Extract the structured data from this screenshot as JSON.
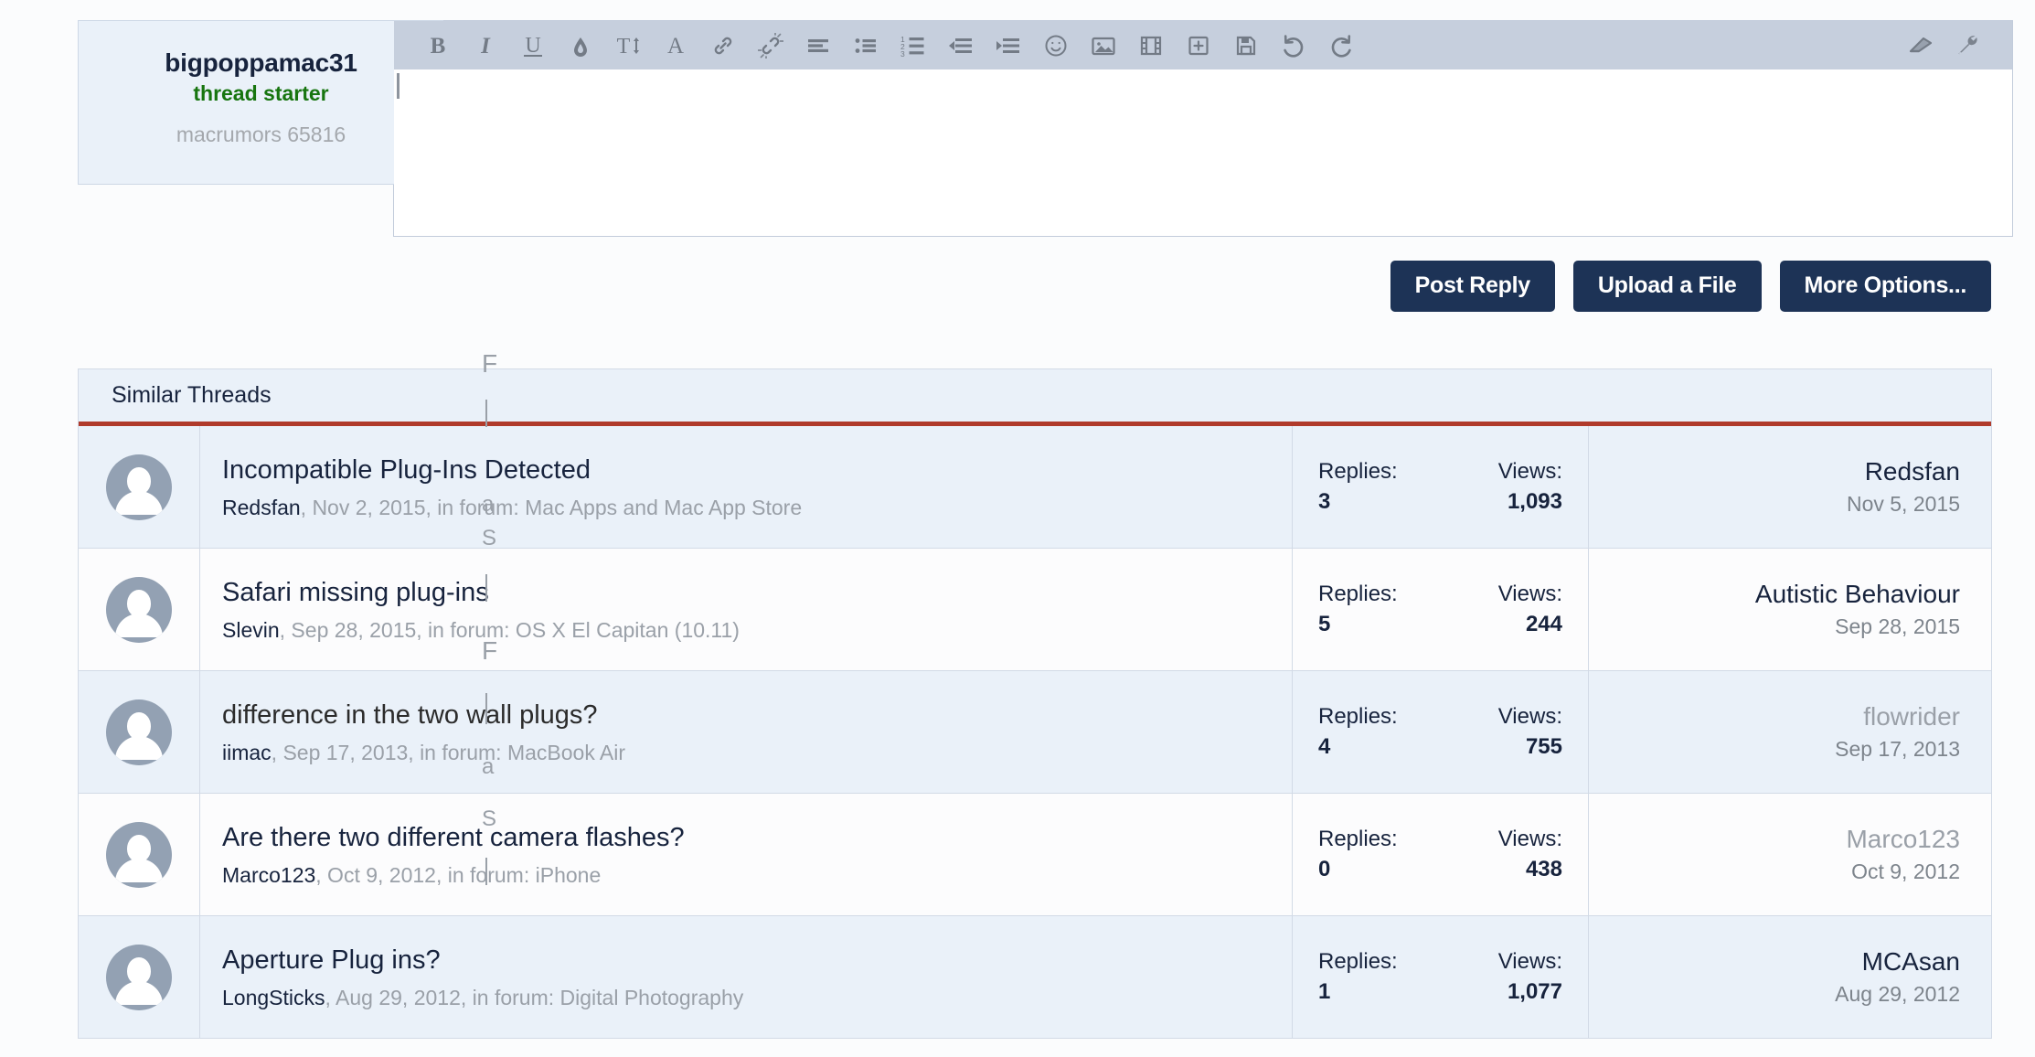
{
  "author": {
    "name": "bigpoppamac31",
    "role": "thread starter",
    "rank": "macrumors 65816"
  },
  "editor": {
    "toolbar_left": [
      {
        "name": "bold-icon",
        "label": "B"
      },
      {
        "name": "italic-icon",
        "label": "I"
      },
      {
        "name": "underline-icon",
        "label": "U"
      },
      {
        "name": "text-color-icon",
        "label": "Text Color"
      },
      {
        "name": "font-size-icon",
        "label": "Font Size"
      },
      {
        "name": "font-family-icon",
        "label": "Font"
      },
      {
        "name": "link-icon",
        "label": "Insert Link"
      },
      {
        "name": "unlink-icon",
        "label": "Remove Link"
      },
      {
        "name": "align-icon",
        "label": "Alignment"
      },
      {
        "name": "bullet-list-icon",
        "label": "Bullet List"
      },
      {
        "name": "numbered-list-icon",
        "label": "Numbered List"
      },
      {
        "name": "outdent-icon",
        "label": "Outdent"
      },
      {
        "name": "indent-icon",
        "label": "Indent"
      },
      {
        "name": "smilie-icon",
        "label": "Smilies"
      },
      {
        "name": "image-icon",
        "label": "Insert Image"
      },
      {
        "name": "media-icon",
        "label": "Insert Media"
      },
      {
        "name": "insert-icon",
        "label": "Insert"
      },
      {
        "name": "draft-save-icon",
        "label": "Save Draft"
      },
      {
        "name": "undo-icon",
        "label": "Undo"
      },
      {
        "name": "redo-icon",
        "label": "Redo"
      }
    ],
    "toolbar_right": [
      {
        "name": "remove-formatting-icon",
        "label": "Remove Formatting"
      },
      {
        "name": "bbcode-toggle-icon",
        "label": "BB Code Editor"
      }
    ],
    "content": "",
    "placeholder": ""
  },
  "actions": {
    "post_reply": "Post Reply",
    "upload_file": "Upload a File",
    "more_options": "More Options..."
  },
  "similar": {
    "heading": "Similar Threads",
    "labels": {
      "replies": "Replies:",
      "views": "Views:"
    },
    "rows": [
      {
        "title": "Incompatible Plug-Ins Detected",
        "title_is_link": true,
        "author": "Redsfan",
        "date": "Nov 2, 2015",
        "forum_prefix": ", in forum: ",
        "forum": "Mac Apps and Mac App Store",
        "replies": "3",
        "views": "1,093",
        "last_user": "Redsfan",
        "last_user_is_link": true,
        "last_date": "Nov 5, 2015"
      },
      {
        "title": "Safari missing plug-ins",
        "title_is_link": true,
        "author": "Slevin",
        "date": "Sep 28, 2015",
        "forum_prefix": ", in forum: ",
        "forum": "OS X El Capitan (10.11)",
        "replies": "5",
        "views": "244",
        "last_user": "Autistic Behaviour",
        "last_user_is_link": true,
        "last_date": "Sep 28, 2015"
      },
      {
        "title": "difference in the two wall plugs?",
        "title_is_link": false,
        "author": "iimac",
        "date": "Sep 17, 2013",
        "forum_prefix": ", in forum: ",
        "forum": "MacBook Air",
        "replies": "4",
        "views": "755",
        "last_user": "flowrider",
        "last_user_is_link": false,
        "last_date": "Sep 17, 2013"
      },
      {
        "title": "Are there two different camera flashes?",
        "title_is_link": true,
        "author": "Marco123",
        "date": "Oct 9, 2012",
        "forum_prefix": ", in forum: ",
        "forum": "iPhone",
        "replies": "0",
        "views": "438",
        "last_user": "Marco123",
        "last_user_is_link": false,
        "last_date": "Oct 9, 2012"
      },
      {
        "title": "Aperture Plug ins?",
        "title_is_link": true,
        "author": "LongSticks",
        "date": "Aug 29, 2012",
        "forum_prefix": ", in forum: ",
        "forum": "Digital Photography",
        "replies": "1",
        "views": "1,077",
        "last_user": "MCAsan",
        "last_user_is_link": true,
        "last_date": "Aug 29, 2012"
      }
    ]
  },
  "overlay_artifacts": {
    "glyphs": [
      "F",
      "S",
      "a",
      "F",
      "h",
      "F",
      "S",
      "a",
      "S",
      "h"
    ]
  },
  "colors": {
    "accent_red": "#b03a2b",
    "button_navy": "#1d3356",
    "toolbar_gray": "#c6cfdd",
    "row_alt": "#eaf1f9",
    "link_navy": "#17233d",
    "green": "#17750f"
  }
}
